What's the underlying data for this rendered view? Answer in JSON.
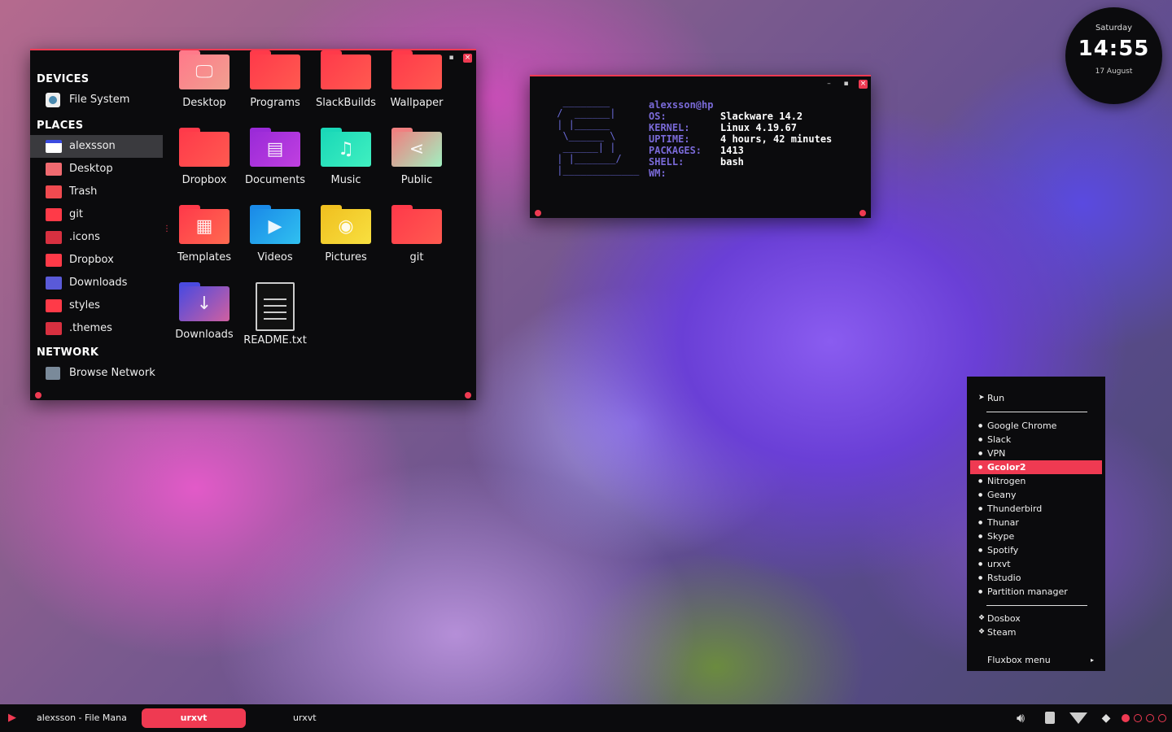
{
  "file_manager": {
    "sections": {
      "devices": "DEVICES",
      "places": "PLACES",
      "network": "NETWORK"
    },
    "devices": [
      {
        "label": "File System",
        "icon": "drive-icon"
      }
    ],
    "places": [
      {
        "label": "alexsson",
        "icon": "home-icon",
        "color": "#3b4be0"
      },
      {
        "label": "Desktop",
        "icon": "desktop-folder-icon",
        "color": "#f06a70"
      },
      {
        "label": "Trash",
        "icon": "trash-icon",
        "color": "#f04a50"
      },
      {
        "label": "git",
        "icon": "folder-icon",
        "color": "#ff3a48"
      },
      {
        "label": ".icons",
        "icon": "folder-icon",
        "color": "#d83040"
      },
      {
        "label": "Dropbox",
        "icon": "folder-icon",
        "color": "#ff3a48"
      },
      {
        "label": "Downloads",
        "icon": "downloads-folder-icon",
        "color": "#5a5ad8"
      },
      {
        "label": "styles",
        "icon": "folder-icon",
        "color": "#ff3a48"
      },
      {
        "label": ".themes",
        "icon": "folder-icon",
        "color": "#d83040"
      }
    ],
    "network": [
      {
        "label": "Browse Network",
        "icon": "network-icon"
      }
    ],
    "items": [
      {
        "label": "Desktop",
        "glyph": "🖵",
        "c1": "#ff7a8a",
        "c2": "#f0a090"
      },
      {
        "label": "Programs",
        "glyph": "",
        "c1": "#ff3a4a",
        "c2": "#ff5a50"
      },
      {
        "label": "SlackBuilds",
        "glyph": "",
        "c1": "#ff3a4a",
        "c2": "#ff5a50"
      },
      {
        "label": "Wallpaper",
        "glyph": "",
        "c1": "#ff3a4a",
        "c2": "#ff5a50"
      },
      {
        "label": "Dropbox",
        "glyph": "",
        "c1": "#ff3a4a",
        "c2": "#ff5a50"
      },
      {
        "label": "Documents",
        "glyph": "▤",
        "c1": "#9a2ad8",
        "c2": "#c040e0"
      },
      {
        "label": "Music",
        "glyph": "♫",
        "c1": "#1ad8b8",
        "c2": "#40f0c0"
      },
      {
        "label": "Public",
        "glyph": "⋖",
        "c1": "#f08080",
        "c2": "#a0f0c0"
      },
      {
        "label": "Templates",
        "glyph": "▦",
        "c1": "#ff3a4a",
        "c2": "#ff6a50"
      },
      {
        "label": "Videos",
        "glyph": "▶",
        "c1": "#1a8ae8",
        "c2": "#30c0f0"
      },
      {
        "label": "Pictures",
        "glyph": "◉",
        "c1": "#f0c020",
        "c2": "#f8e040"
      },
      {
        "label": "git",
        "glyph": "",
        "c1": "#ff3a4a",
        "c2": "#ff5a50"
      },
      {
        "label": "Downloads",
        "glyph": "↓",
        "c1": "#4a4ae0",
        "c2": "#d060a0"
      },
      {
        "label": "README.txt",
        "glyph": "",
        "c1": "",
        "c2": ""
      }
    ]
  },
  "terminal": {
    "ascii": "  ________\n /  ______|\n | |______\n  \\______ \\\n  ______| |\n | |_______/\n |_____________",
    "userhost": "alexsson@hp",
    "rows": [
      {
        "key": "OS:",
        "val": "Slackware 14.2"
      },
      {
        "key": "KERNEL:",
        "val": "Linux 4.19.67"
      },
      {
        "key": "UPTIME:",
        "val": "4 hours, 42 minutes"
      },
      {
        "key": "PACKAGES:",
        "val": "1413"
      },
      {
        "key": "SHELL:",
        "val": "bash"
      },
      {
        "key": "WM:",
        "val": ""
      }
    ]
  },
  "clock": {
    "day": "Saturday",
    "time": "14:55",
    "date": "17 August"
  },
  "menu": {
    "run": "Run",
    "apps": [
      "Google Chrome",
      "Slack",
      "VPN",
      "Gcolor2",
      "Nitrogen",
      "Geany",
      "Thunderbird",
      "Thunar",
      "Skype",
      "Spotify",
      "urxvt",
      "Rstudio",
      "Partition manager"
    ],
    "selected": "Gcolor2",
    "games": [
      "Dosbox",
      "Steam"
    ],
    "submenu": "Fluxbox menu",
    "submenu_arrow": "▸"
  },
  "taskbar": {
    "start_glyph": "▶",
    "tasks": [
      "alexsson - File Mana",
      "urxvt",
      "urxvt"
    ],
    "active_index": 1,
    "tray_icons": [
      "volume-icon",
      "clipboard-icon",
      "wifi-icon",
      "dropbox-icon"
    ],
    "workspaces": 4,
    "active_workspace": 1
  },
  "colors": {
    "accent": "#ef3a52",
    "panel": "#0b0b0d"
  }
}
